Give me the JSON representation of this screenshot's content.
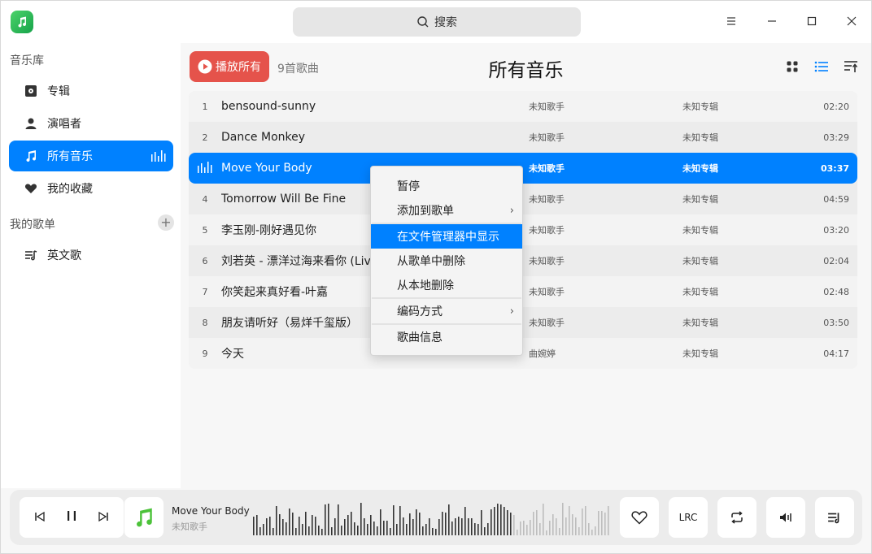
{
  "search": {
    "placeholder": "搜索"
  },
  "sidebar": {
    "library_heading": "音乐库",
    "items": [
      {
        "label": "专辑",
        "icon": "album-icon"
      },
      {
        "label": "演唱者",
        "icon": "singer-icon"
      },
      {
        "label": "所有音乐",
        "icon": "music-note-icon",
        "active": true
      },
      {
        "label": "我的收藏",
        "icon": "heart-icon"
      }
    ],
    "playlists_heading": "我的歌单",
    "add_symbol": "+",
    "playlists": [
      {
        "label": "英文歌",
        "icon": "playlist-icon"
      }
    ]
  },
  "header": {
    "play_all_label": "播放所有",
    "song_count": "9首歌曲",
    "title": "所有音乐"
  },
  "songs": [
    {
      "num": "1",
      "title": "bensound-sunny",
      "artist": "未知歌手",
      "album": "未知专辑",
      "duration": "02:20"
    },
    {
      "num": "2",
      "title": "Dance Monkey",
      "artist": "未知歌手",
      "album": "未知专辑",
      "duration": "03:29"
    },
    {
      "num": "",
      "title": "Move Your Body",
      "artist": "未知歌手",
      "album": "未知专辑",
      "duration": "03:37",
      "playing": true
    },
    {
      "num": "4",
      "title": "Tomorrow Will Be Fine",
      "artist": "未知歌手",
      "album": "未知专辑",
      "duration": "04:59"
    },
    {
      "num": "5",
      "title": "李玉刚-刚好遇见你",
      "artist": "未知歌手",
      "album": "未知专辑",
      "duration": "03:20"
    },
    {
      "num": "6",
      "title": "刘若英 - 漂洋过海来看你 (Live",
      "artist": "未知歌手",
      "album": "未知专辑",
      "duration": "02:04"
    },
    {
      "num": "7",
      "title": "你笑起来真好看-叶嘉",
      "artist": "未知歌手",
      "album": "未知专辑",
      "duration": "02:48"
    },
    {
      "num": "8",
      "title": "朋友请听好（易烊千玺版）",
      "artist": "未知歌手",
      "album": "未知专辑",
      "duration": "03:50"
    },
    {
      "num": "9",
      "title": "今天",
      "artist": "曲婉婷",
      "album": "未知专辑",
      "duration": "04:17"
    }
  ],
  "context_menu": {
    "items": [
      {
        "label": "暂停"
      },
      {
        "label": "添加到歌单",
        "submenu": true
      },
      {
        "label": "在文件管理器中显示",
        "highlighted": true
      },
      {
        "label": "从歌单中删除"
      },
      {
        "label": "从本地删除"
      },
      {
        "label": "编码方式",
        "submenu": true
      },
      {
        "label": "歌曲信息"
      }
    ]
  },
  "player": {
    "title": "Move Your Body",
    "artist": "未知歌手",
    "lrc_label": "LRC"
  },
  "colors": {
    "accent": "#0081ff",
    "play_all": "#e5534b",
    "brand": "#22b14c"
  }
}
